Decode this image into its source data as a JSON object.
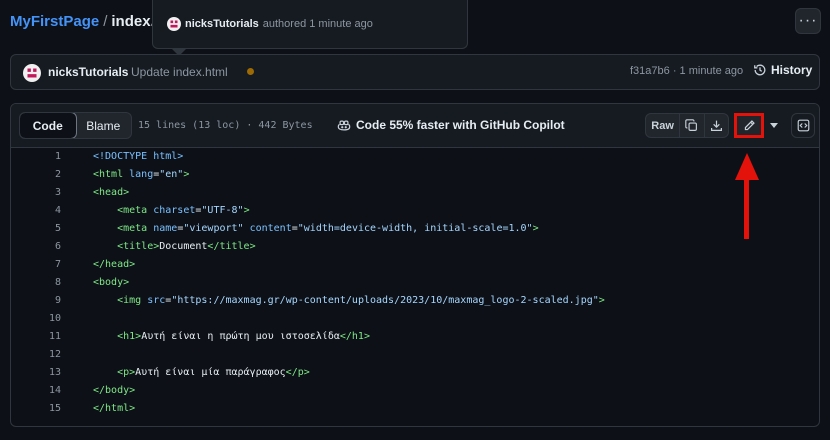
{
  "breadcrumb": {
    "repo": "MyFirstPage",
    "separator": "/",
    "file": "index.ht"
  },
  "popup": {
    "author": "nicksTutorials",
    "text": "authored 1 minute ago"
  },
  "commit": {
    "author": "nicksTutorials",
    "message": "Update index.html",
    "sha_time": "f31a7b6 · 1 minute ago",
    "history_label": "History",
    "status_color": "#9e6a03"
  },
  "file": {
    "tabs": [
      {
        "label": "Code",
        "active": true
      },
      {
        "label": "Blame",
        "active": false
      }
    ],
    "meta": "15 lines (13 loc) · 442 Bytes",
    "copilot": "Code 55% faster with GitHub Copilot",
    "raw_label": "Raw",
    "icons": [
      "copy-icon",
      "download-icon",
      "pencil-icon",
      "triangle-down-icon",
      "code-square-icon"
    ],
    "highlight_color": "#e3120b"
  },
  "lines": [
    {
      "n": "1"
    },
    {
      "n": "2"
    },
    {
      "n": "3"
    },
    {
      "n": "4"
    },
    {
      "n": "5"
    },
    {
      "n": "6"
    },
    {
      "n": "7"
    },
    {
      "n": "8"
    },
    {
      "n": "9"
    },
    {
      "n": "10"
    },
    {
      "n": "11"
    },
    {
      "n": "12"
    },
    {
      "n": "13"
    },
    {
      "n": "14"
    },
    {
      "n": "15"
    }
  ],
  "code": {
    "l1": "<!DOCTYPE html>",
    "l2_tag": "<html",
    "l2_attr": " lang",
    "l2_eq": "=",
    "l2_str": "\"en\"",
    "l2_close": ">",
    "l3": "<head>",
    "l4_tag": "<meta",
    "l4_attr": " charset",
    "l4_eq": "=",
    "l4_str": "\"UTF-8\"",
    "l4_close": ">",
    "l5_tag": "<meta",
    "l5_attr1": " name",
    "l5_eq1": "=",
    "l5_str1": "\"viewport\"",
    "l5_attr2": " content",
    "l5_eq2": "=",
    "l5_str2": "\"width=device-width, initial-scale=1.0\"",
    "l5_close": ">",
    "l6_open": "<title>",
    "l6_text": "Document",
    "l6_close": "</title>",
    "l7": "</head>",
    "l8": "<body>",
    "l9_tag": "<img",
    "l9_attr": " src",
    "l9_eq": "=",
    "l9_str": "\"https://maxmag.gr/wp-content/uploads/2023/10/maxmag_logo-2-scaled.jpg\"",
    "l9_close": ">",
    "l11_open": "<h1>",
    "l11_text": "Αυτή είναι η πρώτη μου ιστοσελίδα",
    "l11_close": "</h1>",
    "l13_open": "<p>",
    "l13_text": "Αυτή είναι μία παράγραφος",
    "l13_close": "</p>",
    "l14": "</body>",
    "l15": "</html>"
  }
}
